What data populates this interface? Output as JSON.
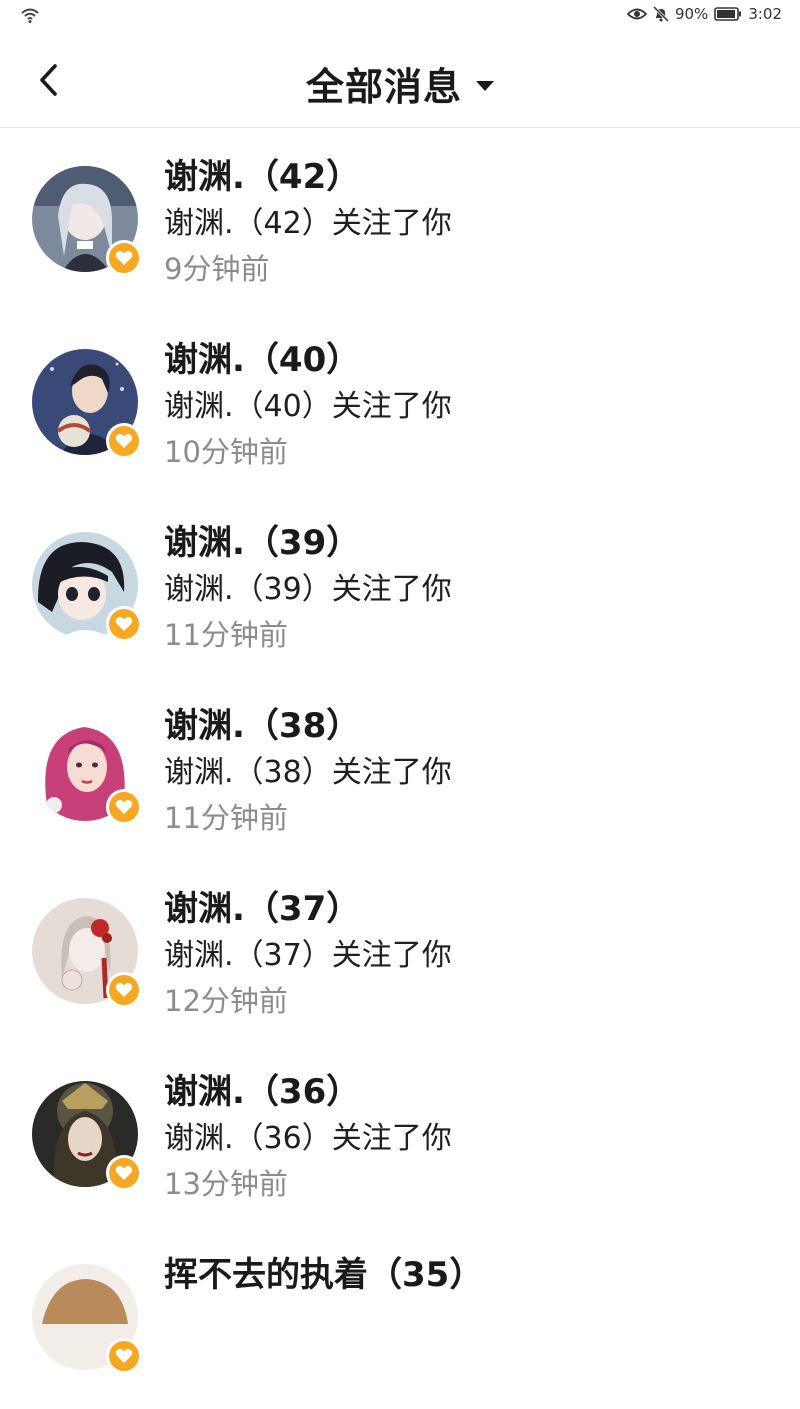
{
  "status_bar": {
    "battery_percent": "90%",
    "time": "3:02",
    "icons": [
      "wifi-icon",
      "eye-icon",
      "mute-bell-icon",
      "battery-icon"
    ]
  },
  "header": {
    "title": "全部消息",
    "back_icon": "chevron-left-icon",
    "dropdown_icon": "caret-down-icon"
  },
  "colors": {
    "badge": "#f7a823",
    "time_text": "#8c8c8c",
    "divider": "#e3e3e3"
  },
  "messages": [
    {
      "name": "谢渊.（42）",
      "text": "谢渊.（42）关注了你",
      "time": "9分钟前",
      "badge_icon": "heart-icon"
    },
    {
      "name": "谢渊.（40）",
      "text": "谢渊.（40）关注了你",
      "time": "10分钟前",
      "badge_icon": "heart-icon"
    },
    {
      "name": "谢渊.（39）",
      "text": "谢渊.（39）关注了你",
      "time": "11分钟前",
      "badge_icon": "heart-icon"
    },
    {
      "name": "谢渊.（38）",
      "text": "谢渊.（38）关注了你",
      "time": "11分钟前",
      "badge_icon": "heart-icon"
    },
    {
      "name": "谢渊.（37）",
      "text": "谢渊.（37）关注了你",
      "time": "12分钟前",
      "badge_icon": "heart-icon"
    },
    {
      "name": "谢渊.（36）",
      "text": "谢渊.（36）关注了你",
      "time": "13分钟前",
      "badge_icon": "heart-icon"
    },
    {
      "name": "挥不去的执着（35）",
      "text": "",
      "time": "",
      "badge_icon": "heart-icon"
    }
  ]
}
